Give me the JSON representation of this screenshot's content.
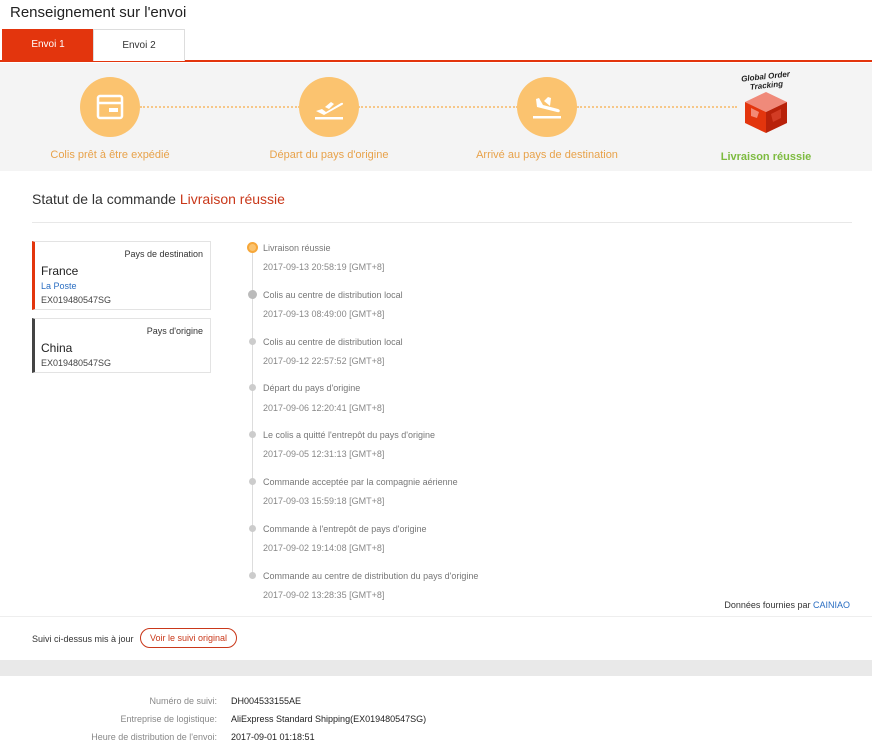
{
  "page": {
    "title": "Renseignement sur l'envoi"
  },
  "tabs": [
    {
      "label": "Envoi 1",
      "active": true
    },
    {
      "label": "Envoi 2",
      "active": false
    }
  ],
  "progress": {
    "steps": [
      {
        "label": "Colis prêt à être expédié",
        "icon": "package-icon"
      },
      {
        "label": "Départ du pays d'origine",
        "icon": "plane-takeoff-icon"
      },
      {
        "label": "Arrivé au pays de destination",
        "icon": "plane-landing-icon"
      },
      {
        "label": "Livraison réussie",
        "icon": "global-order-tracking-logo"
      }
    ],
    "logo_text": "Global Order Tracking",
    "colors": {
      "step_circle": "#fbc36f",
      "step_label": "#e8a24a",
      "done_label": "#7dbb3f",
      "accent": "#e3350d"
    }
  },
  "status": {
    "prefix": "Statut de la commande",
    "value": "Livraison réussie"
  },
  "destination": {
    "label": "Pays de destination",
    "country": "France",
    "carrier": "La Poste",
    "tracking": "EX019480547SG"
  },
  "origin": {
    "label": "Pays d'origine",
    "country": "China",
    "tracking": "EX019480547SG"
  },
  "timeline": [
    {
      "event": "Livraison réussie",
      "time": "2017-09-13 20:58:19 [GMT+8]"
    },
    {
      "event": "Colis au centre de distribution local",
      "time": "2017-09-13 08:49:00 [GMT+8]"
    },
    {
      "event": "Colis au centre de distribution local",
      "time": "2017-09-12 22:57:52 [GMT+8]"
    },
    {
      "event": "Départ du pays d'origine",
      "time": "2017-09-06 12:20:41 [GMT+8]"
    },
    {
      "event": "Le colis a quitté l'entrepôt du pays d'origine",
      "time": "2017-09-05 12:31:13 [GMT+8]"
    },
    {
      "event": "Commande acceptée par la compagnie aérienne",
      "time": "2017-09-03 15:59:18 [GMT+8]"
    },
    {
      "event": "Commande à l'entrepôt de pays d'origine",
      "time": "2017-09-02 19:14:08 [GMT+8]"
    },
    {
      "event": "Commande au centre de distribution du pays d'origine",
      "time": "2017-09-02 13:28:35 [GMT+8]"
    }
  ],
  "source": {
    "prefix": "Données fournies par",
    "provider": "CAINIAO"
  },
  "footer": {
    "updated_text": "Suivi ci-dessus mis à jour",
    "button_label": "Voir le suivi original"
  },
  "details": [
    {
      "label": "Numéro de suivi:",
      "value": "DH004533155AE"
    },
    {
      "label": "Entreprise de logistique:",
      "value": "AliExpress Standard Shipping(EX019480547SG)"
    },
    {
      "label": "Heure de distribution de l'envoi:",
      "value": "2017-09-01 01:18:51"
    }
  ]
}
